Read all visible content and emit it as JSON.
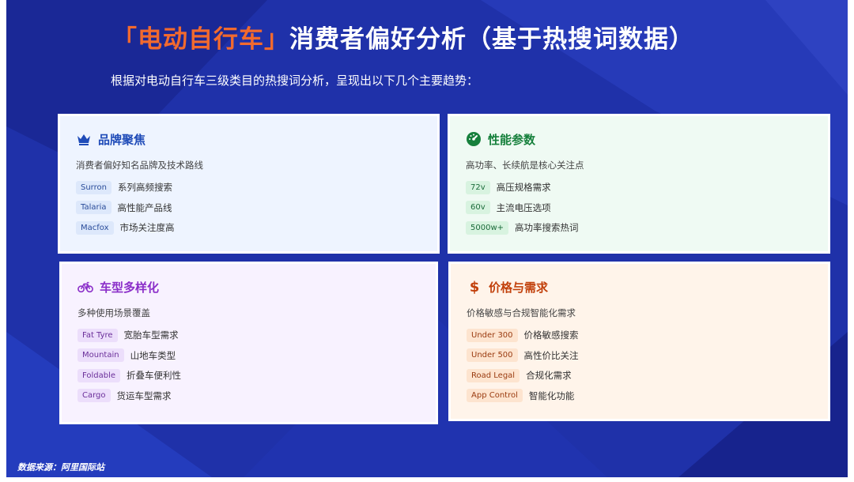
{
  "header": {
    "title_accent": "「电动自行车」",
    "title_rest": "消费者偏好分析（基于热搜词数据）",
    "subtitle": "根据对电动自行车三级类目的热搜词分析，呈现出以下几个主要趋势："
  },
  "cards": {
    "brand": {
      "icon": "crown-icon",
      "title": "品牌聚焦",
      "desc": "消费者偏好知名品牌及技术路线",
      "items": [
        {
          "tag": "Surron",
          "text": "系列高频搜索"
        },
        {
          "tag": "Talaria",
          "text": "高性能产品线"
        },
        {
          "tag": "Macfox",
          "text": "市场关注度高"
        }
      ]
    },
    "performance": {
      "icon": "speedometer-icon",
      "title": "性能参数",
      "desc": "高功率、长续航是核心关注点",
      "items": [
        {
          "tag": "72v",
          "text": "高压规格需求"
        },
        {
          "tag": "60v",
          "text": "主流电压选项"
        },
        {
          "tag": "5000w+",
          "text": "高功率搜索热词"
        }
      ]
    },
    "models": {
      "icon": "bicycle-icon",
      "title": "车型多样化",
      "desc": "多种使用场景覆盖",
      "items": [
        {
          "tag": "Fat Tyre",
          "text": "宽胎车型需求"
        },
        {
          "tag": "Mountain",
          "text": "山地车类型"
        },
        {
          "tag": "Foldable",
          "text": "折叠车便利性"
        },
        {
          "tag": "Cargo",
          "text": "货运车型需求"
        }
      ]
    },
    "price": {
      "icon": "dollar-icon",
      "title": "价格与需求",
      "desc": "价格敏感与合规智能化需求",
      "items": [
        {
          "tag": "Under 300",
          "text": "价格敏感搜索"
        },
        {
          "tag": "Under 500",
          "text": "高性价比关注"
        },
        {
          "tag": "Road Legal",
          "text": "合规化需求"
        },
        {
          "tag": "App Control",
          "text": "智能化功能"
        }
      ]
    }
  },
  "footer": {
    "source": "数据来源：阿里国际站"
  },
  "colors": {
    "background": "#1e2fa8",
    "accent": "#f26a2e"
  }
}
